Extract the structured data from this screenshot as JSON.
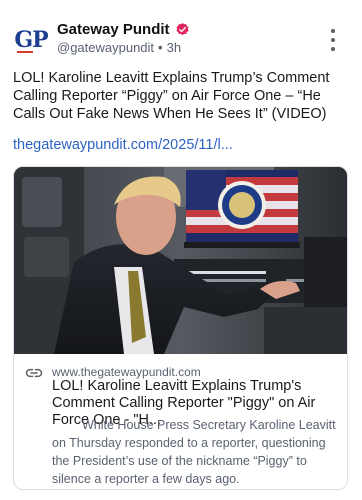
{
  "post": {
    "author": {
      "display_name": "Gateway Pundit",
      "handle": "@gatewaypundit",
      "time_ago": "3h",
      "avatar_text": "GP",
      "verified_icon": "verified-badge-icon",
      "verified_color": "#e0245e"
    },
    "menu_icon": "kebab-menu-icon",
    "text": "LOL! Karoline Leavitt Explains Trump’s Comment Calling Reporter “Piggy” on Air Force One – “He Calls Out Fake News When He Sees It” (VIDEO)",
    "link_text": "thegatewaypundit.com/2025/11/l...",
    "link_color": "#2e63c4",
    "card": {
      "link_icon": "link-icon",
      "domain": "www.thegatewaypundit.com",
      "title": "LOL! Karoline Leavitt Explains Trump's Comment Calling Reporter \"Piggy\" on Air Force One - \"H...",
      "description": "White House Press Secretary Karoline Leavitt on Thursday responded to a reporter, questioning the President’s use of the nickname “Piggy” to silence a reporter a few days ago."
    }
  }
}
